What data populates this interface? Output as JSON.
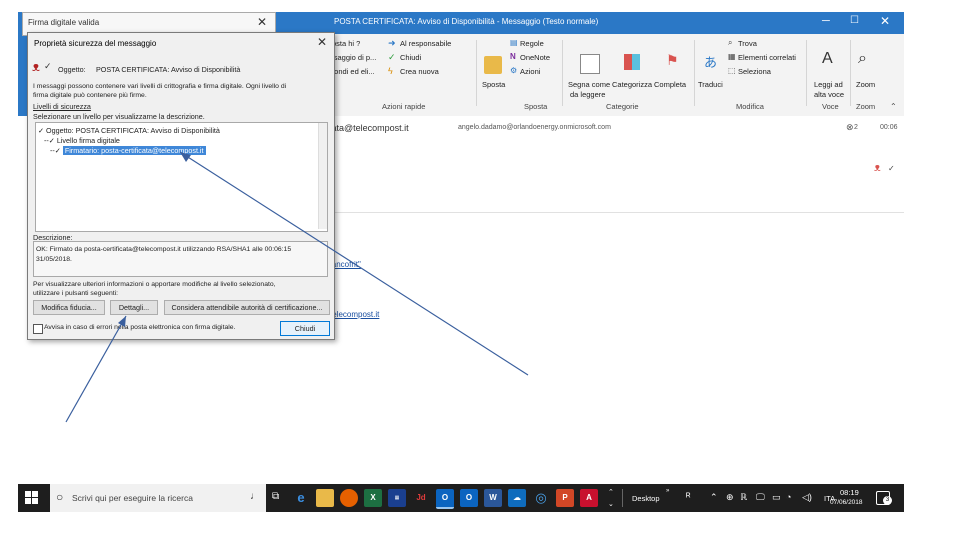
{
  "outlook": {
    "window_title": "POSTA CERTIFICATA: Avviso di Disponibilità - Messaggio (Testo normale)",
    "ribbon": {
      "quick_steps": [
        "osta hi ?",
        "ssaggio di p...",
        "pondi ed eli..."
      ],
      "quick_steps_right": [
        "Al responsabile",
        "Chiudi",
        "Crea nuova"
      ],
      "group_quick": "Azioni rapide",
      "regole": "Regole",
      "onenote": "OneNote",
      "azioni": "Azioni",
      "sposta": "Sposta",
      "group_sposta": "Sposta",
      "segna": "Segna come",
      "segna2": "da leggere",
      "categorizza": "Categorizza",
      "completa": "Completa",
      "group_tag": "Categorie",
      "traduci": "Traduci",
      "trova": "Trova",
      "elementi": "Elementi correlati",
      "seleziona": "Seleziona",
      "group_modifica": "Modifica",
      "leggi": "Leggi ad",
      "leggi2": "alta voce",
      "group_voce": "Voce",
      "zoom": "Zoom",
      "group_zoom": "Zoom"
    },
    "header": {
      "sender": "tificata@telecompost.it",
      "recipient": "angelo.dadamo@orlandoenergy.onmicrosoft.com",
      "count": "2",
      "time": "00:06",
      "link1": "iancofrit\"",
      "link2": "telecompost.it"
    }
  },
  "dialog_back": {
    "title": "Firma digitale valida"
  },
  "dialog": {
    "title": "Proprietà sicurezza del messaggio",
    "subject_label": "Oggetto:",
    "subject_value": "POSTA CERTIFICATA: Avviso di Disponibilità",
    "info_line1": "I messaggi possono contenere vari livelli di crittografia e firma digitale. Ogni livello di",
    "info_line2": "firma digitale può contenere più firme.",
    "levels_label": "Livelli di sicurezza",
    "levels_hint": "Selezionare un livello per visualizzarne la descrizione.",
    "tree": [
      "Oggetto: POSTA CERTIFICATA: Avviso di Disponibilità",
      "Livello firma digitale",
      "Firmatario: posta-certificata@telecompost.it"
    ],
    "description_label": "Descrizione:",
    "description_line1": "OK: Firmato da posta-certificata@telecompost.it utilizzando RSA/SHA1 alle 00:06:15",
    "description_line2": "31/05/2018.",
    "extra_line1": "Per visualizzare ulteriori informazioni o apportare modifiche al livello selezionato,",
    "extra_line2": "utilizzare i pulsanti seguenti:",
    "btn_edit_trust": "Modifica fiducia...",
    "btn_details": "Dettagli...",
    "btn_trust_ca": "Considera attendibile autorità di certificazione...",
    "checkbox_label": "Avvisa in caso di errori nella posta elettronica con firma digitale.",
    "btn_close": "Chiudi"
  },
  "taskbar": {
    "search_placeholder": "Scrivi qui per eseguire la ricerca",
    "desktop_label": "Desktop",
    "lang": "ITA",
    "time": "08:19",
    "date": "07/06/2018",
    "notifications": "3"
  },
  "colors": {
    "outlook_blue": "#2b78c6",
    "arrow_blue": "#3a5f9e",
    "selection": "#3f87d8"
  }
}
